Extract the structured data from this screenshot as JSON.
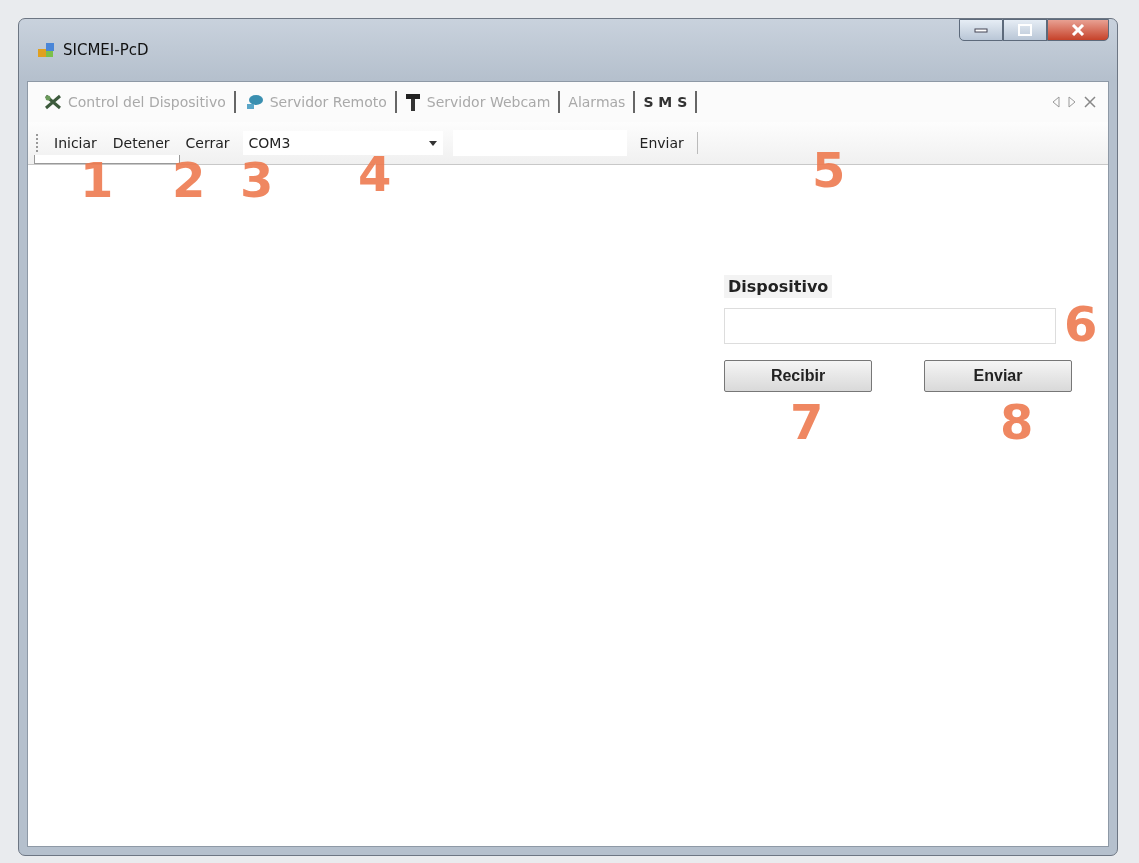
{
  "window": {
    "title": "SICMEI-PcD"
  },
  "tabs": [
    {
      "label": "Control del Dispositivo",
      "selected": false
    },
    {
      "label": "Servidor Remoto",
      "selected": false
    },
    {
      "label": "Servidor Webcam",
      "selected": false
    },
    {
      "label": "Alarmas",
      "selected": false
    },
    {
      "label": "S M S",
      "selected": true
    }
  ],
  "toolbar": [
    {
      "kind": "button",
      "label": "Iniciar"
    },
    {
      "kind": "button",
      "label": "Detener"
    },
    {
      "kind": "button",
      "label": "Cerrar"
    },
    {
      "kind": "combo",
      "value": "COM3"
    },
    {
      "kind": "field"
    },
    {
      "kind": "button",
      "label": "Enviar"
    }
  ],
  "panel": {
    "label": "Dispositivo",
    "buttons": [
      "Recibir",
      "Enviar"
    ]
  },
  "callouts": [
    "1",
    "2",
    "3",
    "4",
    "5",
    "6",
    "7",
    "8"
  ]
}
